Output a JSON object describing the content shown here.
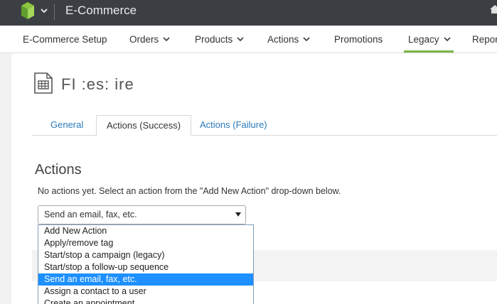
{
  "app": {
    "title": "E-Commerce"
  },
  "nav": {
    "items": [
      {
        "label": "E-Commerce Setup",
        "has_caret": false
      },
      {
        "label": "Orders",
        "has_caret": true
      },
      {
        "label": "Products",
        "has_caret": true
      },
      {
        "label": "Actions",
        "has_caret": true
      },
      {
        "label": "Promotions",
        "has_caret": false
      },
      {
        "label": "Legacy",
        "has_caret": true,
        "active": true
      },
      {
        "label": "Repor",
        "has_caret": false
      }
    ]
  },
  "page": {
    "title": "FI :es: ire"
  },
  "tabs": [
    {
      "label": "General"
    },
    {
      "label": "Actions (Success)",
      "active": true
    },
    {
      "label": "Actions (Failure)"
    }
  ],
  "actions": {
    "heading": "Actions",
    "help": "No actions yet. Select an action from the \"Add New Action\" drop-down below.",
    "select_value": "Send an email, fax, etc.",
    "options": [
      "Add New Action",
      "Apply/remove tag",
      "Start/stop a campaign (legacy)",
      "Start/stop a follow-up sequence",
      "Send an email, fax, etc.",
      "Assign a contact to a user",
      "Create an appointment"
    ],
    "selected_index": 4
  },
  "colors": {
    "accent": "#7ab648",
    "link": "#2a7ab9",
    "highlight": "#1e90ff",
    "topbar": "#3b3f44"
  }
}
